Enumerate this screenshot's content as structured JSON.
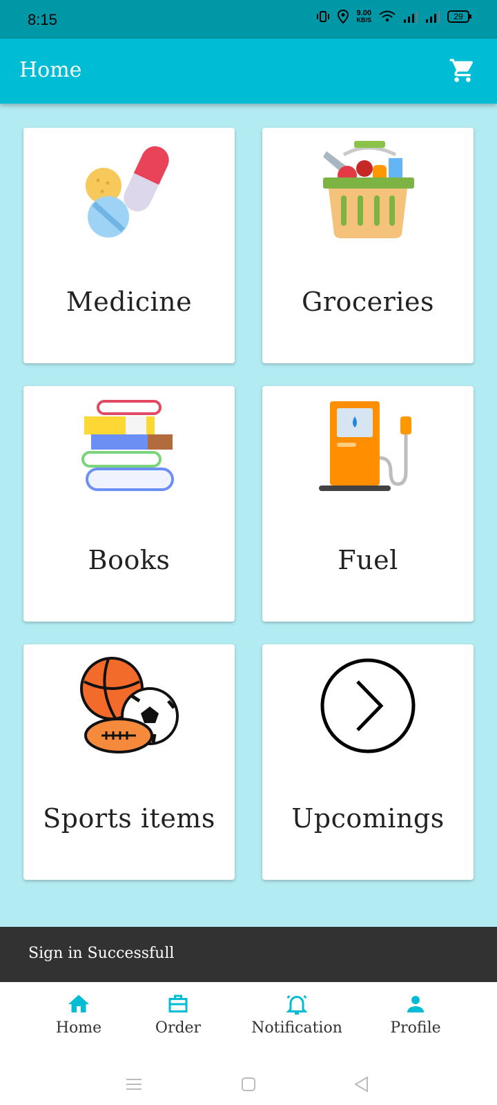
{
  "status_bar": {
    "time": "8:15",
    "net_speed_value": "9.00",
    "net_speed_unit": "KB/S",
    "battery": "29",
    "icons": [
      "vibrate-icon",
      "location-icon",
      "wifi-icon",
      "signal-icon",
      "signal-icon",
      "battery-icon"
    ]
  },
  "app_bar": {
    "title": "Home",
    "cart_icon": "cart-icon"
  },
  "categories": [
    {
      "label": "Medicine",
      "icon": "medicine-icon"
    },
    {
      "label": "Groceries",
      "icon": "groceries-basket-icon"
    },
    {
      "label": "Books",
      "icon": "books-stack-icon"
    },
    {
      "label": "Fuel",
      "icon": "fuel-pump-icon"
    },
    {
      "label": "Sports items",
      "icon": "sports-balls-icon"
    },
    {
      "label": "Upcomings",
      "icon": "chevron-circle-icon"
    }
  ],
  "snackbar": {
    "message": "Sign in Successfull"
  },
  "bottom_nav": [
    {
      "label": "Home",
      "icon": "home-icon"
    },
    {
      "label": "Order",
      "icon": "briefcase-icon"
    },
    {
      "label": "Notification",
      "icon": "bell-icon"
    },
    {
      "label": "Profile",
      "icon": "person-icon"
    }
  ],
  "colors": {
    "primary": "#00bcd4",
    "status_bar": "#0097a7",
    "background": "#b2ebf2",
    "snackbar": "#323232"
  }
}
